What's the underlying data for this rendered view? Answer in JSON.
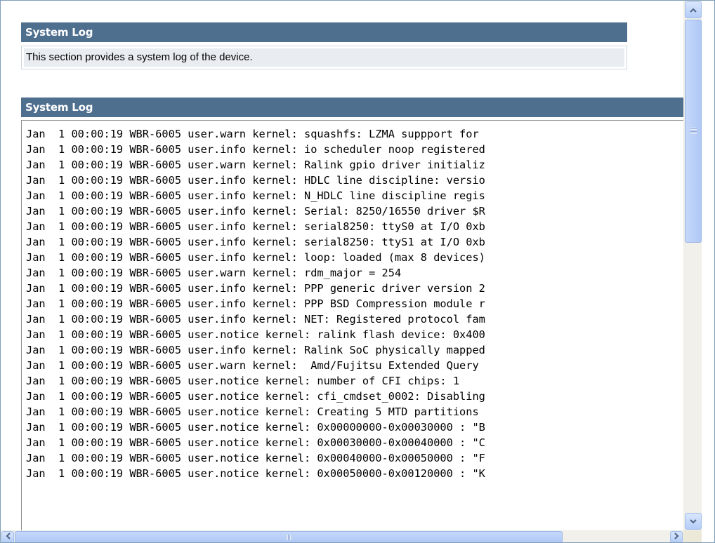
{
  "intro_section": {
    "title": "System Log",
    "description": "This section provides a system log of the device."
  },
  "log_section": {
    "title": "System Log",
    "lines": [
      "Jan  1 00:00:19 WBR-6005 user.warn kernel: squashfs: LZMA suppport for",
      "Jan  1 00:00:19 WBR-6005 user.info kernel: io scheduler noop registered",
      "Jan  1 00:00:19 WBR-6005 user.warn kernel: Ralink gpio driver initializ",
      "Jan  1 00:00:19 WBR-6005 user.info kernel: HDLC line discipline: versio",
      "Jan  1 00:00:19 WBR-6005 user.info kernel: N_HDLC line discipline regis",
      "Jan  1 00:00:19 WBR-6005 user.info kernel: Serial: 8250/16550 driver $R",
      "Jan  1 00:00:19 WBR-6005 user.info kernel: serial8250: ttyS0 at I/O 0xb",
      "Jan  1 00:00:19 WBR-6005 user.info kernel: serial8250: ttyS1 at I/O 0xb",
      "Jan  1 00:00:19 WBR-6005 user.info kernel: loop: loaded (max 8 devices)",
      "Jan  1 00:00:19 WBR-6005 user.warn kernel: rdm_major = 254",
      "Jan  1 00:00:19 WBR-6005 user.info kernel: PPP generic driver version 2",
      "Jan  1 00:00:19 WBR-6005 user.info kernel: PPP BSD Compression module r",
      "Jan  1 00:00:19 WBR-6005 user.info kernel: NET: Registered protocol fam",
      "Jan  1 00:00:19 WBR-6005 user.notice kernel: ralink flash device: 0x400",
      "Jan  1 00:00:19 WBR-6005 user.info kernel: Ralink SoC physically mapped",
      "Jan  1 00:00:19 WBR-6005 user.warn kernel:  Amd/Fujitsu Extended Query",
      "Jan  1 00:00:19 WBR-6005 user.notice kernel: number of CFI chips: 1",
      "Jan  1 00:00:19 WBR-6005 user.notice kernel: cfi_cmdset_0002: Disabling",
      "Jan  1 00:00:19 WBR-6005 user.notice kernel: Creating 5 MTD partitions",
      "Jan  1 00:00:19 WBR-6005 user.notice kernel: 0x00000000-0x00030000 : \"B",
      "Jan  1 00:00:19 WBR-6005 user.notice kernel: 0x00030000-0x00040000 : \"C",
      "Jan  1 00:00:19 WBR-6005 user.notice kernel: 0x00040000-0x00050000 : \"F",
      "Jan  1 00:00:19 WBR-6005 user.notice kernel: 0x00050000-0x00120000 : \"K"
    ]
  },
  "scrollbars": {
    "up_icon": "arrow-up-icon",
    "down_icon": "arrow-down-icon",
    "left_icon": "arrow-left-icon",
    "right_icon": "arrow-right-icon"
  },
  "colors": {
    "header_bg": "#4f6f8f",
    "header_text": "#ffffff",
    "description_bg": "#e9edf1"
  }
}
